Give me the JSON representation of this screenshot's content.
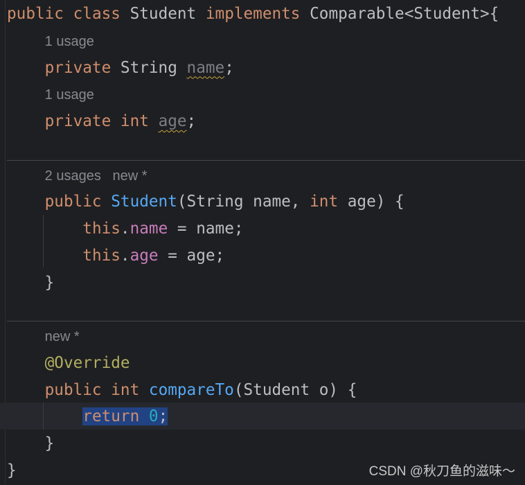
{
  "colors": {
    "background": "#1e1f22",
    "keyword": "#cf8e6d",
    "field": "#c77dbb",
    "method": "#56a8f5",
    "number": "#2aacb8",
    "annotation": "#b3ae60",
    "hint": "#868a91",
    "selection": "#214283"
  },
  "lines": [
    {
      "kind": "code",
      "tokens": [
        [
          "public ",
          "kw"
        ],
        [
          "class ",
          "kw"
        ],
        [
          "Student ",
          "cls"
        ],
        [
          "implements ",
          "kw"
        ],
        [
          "Comparable<Student>{",
          "cls"
        ]
      ]
    },
    {
      "kind": "hint",
      "tokens": [
        [
          "    ",
          ""
        ],
        [
          "1 usage",
          "hint"
        ]
      ]
    },
    {
      "kind": "code",
      "tokens": [
        [
          "    ",
          ""
        ],
        [
          "private ",
          "kw"
        ],
        [
          "String ",
          "cls"
        ],
        [
          "name",
          "unused"
        ],
        [
          ";",
          "cls"
        ]
      ]
    },
    {
      "kind": "hint",
      "tokens": [
        [
          "    ",
          ""
        ],
        [
          "1 usage",
          "hint"
        ]
      ]
    },
    {
      "kind": "code",
      "tokens": [
        [
          "    ",
          ""
        ],
        [
          "private ",
          "kw"
        ],
        [
          "int ",
          "kw"
        ],
        [
          "age",
          "unused"
        ],
        [
          ";",
          "cls"
        ]
      ]
    },
    {
      "kind": "blank",
      "tokens": []
    },
    {
      "kind": "hint",
      "tokens": [
        [
          "    ",
          ""
        ],
        [
          "2 usages   new *",
          "hint"
        ]
      ]
    },
    {
      "kind": "code",
      "tokens": [
        [
          "    ",
          ""
        ],
        [
          "public ",
          "kw"
        ],
        [
          "Student",
          "mth"
        ],
        [
          "(String name, ",
          "cls"
        ],
        [
          "int ",
          "kw"
        ],
        [
          "age) {",
          "cls"
        ]
      ]
    },
    {
      "kind": "code",
      "tokens": [
        [
          "        ",
          ""
        ],
        [
          "this",
          "kw"
        ],
        [
          ".",
          "cls"
        ],
        [
          "name",
          "fld"
        ],
        [
          " = name;",
          "cls"
        ]
      ]
    },
    {
      "kind": "code",
      "tokens": [
        [
          "        ",
          ""
        ],
        [
          "this",
          "kw"
        ],
        [
          ".",
          "cls"
        ],
        [
          "age",
          "fld"
        ],
        [
          " = age;",
          "cls"
        ]
      ]
    },
    {
      "kind": "code",
      "tokens": [
        [
          "    ",
          ""
        ],
        [
          "}",
          "cls"
        ]
      ]
    },
    {
      "kind": "blank",
      "tokens": []
    },
    {
      "kind": "hint",
      "tokens": [
        [
          "    ",
          ""
        ],
        [
          "new *",
          "hint"
        ]
      ]
    },
    {
      "kind": "code",
      "tokens": [
        [
          "    ",
          ""
        ],
        [
          "@Override",
          "ann"
        ]
      ]
    },
    {
      "kind": "code",
      "tokens": [
        [
          "    ",
          ""
        ],
        [
          "public ",
          "kw"
        ],
        [
          "int ",
          "kw"
        ],
        [
          "compareTo",
          "mth"
        ],
        [
          "(Student o) {",
          "cls"
        ]
      ]
    },
    {
      "kind": "code",
      "tokens": [
        [
          "        ",
          ""
        ],
        [
          "return ",
          "kw sel"
        ],
        [
          "0",
          "num sel"
        ],
        [
          ";",
          "cls sel"
        ]
      ]
    },
    {
      "kind": "code",
      "tokens": [
        [
          "    ",
          ""
        ],
        [
          "}",
          "cls"
        ]
      ]
    },
    {
      "kind": "code",
      "tokens": [
        [
          "}",
          "cls"
        ]
      ]
    }
  ],
  "watermark": "CSDN @秋刀鱼的滋味～"
}
